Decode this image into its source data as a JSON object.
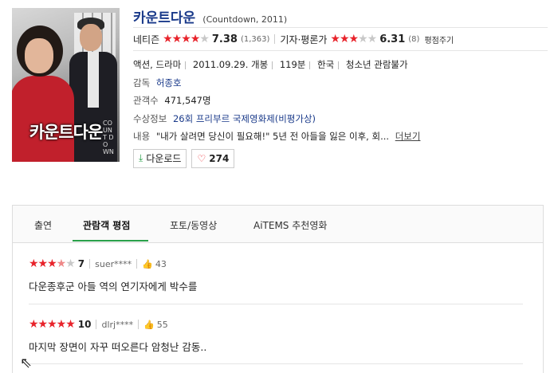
{
  "poster": {
    "title_text": "카운트다운",
    "side_text": "COUNT DOWN"
  },
  "movie": {
    "title": "카운트다운",
    "subtitle": "(Countdown, 2011)",
    "netizen": {
      "label": "네티즌",
      "stars": "★★★★",
      "stars_off": "★",
      "score": "7.38",
      "count": "(1,363)"
    },
    "critic": {
      "label": "기자·평론가",
      "stars": "★★★",
      "stars_off": "★★",
      "score": "6.31",
      "count": "(8)",
      "rate_link": "평점주기"
    },
    "genre": "액션, 드라마",
    "release": "2011.09.29. 개봉",
    "runtime": "119분",
    "country": "한국",
    "grade": "청소년 관람불가",
    "director_label": "감독",
    "director": "허종호",
    "audience_label": "관객수",
    "audience": "471,547명",
    "award_label": "수상정보",
    "award": "26회 프리부르 국제영화제(비평가상)",
    "plot_label": "내용",
    "plot": "\"내가 살려면 당신이 필요해!\" 5년 전 아들을 잃은 이후, 회...",
    "more": "더보기"
  },
  "buttons": {
    "download": "다운로드",
    "likes": "274"
  },
  "tabs": [
    "출연",
    "관람객 평점",
    "포토/동영상",
    "AiTEMS 추천영화"
  ],
  "reviews": [
    {
      "stars": "★★★",
      "half": "★",
      "stars_off": "★",
      "score": "7",
      "user": "suer****",
      "likes": "43",
      "text": "다운종후군 아들 역의 연기자에게 박수를"
    },
    {
      "stars": "★★★★★",
      "half": "",
      "stars_off": "",
      "score": "10",
      "user": "dlrj****",
      "likes": "55",
      "text": "마지막 장면이 자꾸 떠오른다 암청난 감동.."
    }
  ],
  "colors": {
    "accent_red": "#e8232b",
    "link_blue": "#1a3a8a",
    "tab_green": "#2aa04a"
  },
  "icons": {
    "download": "download-icon",
    "heart": "heart-icon",
    "thumb": "thumbs-up-icon",
    "cursor": "mouse-pointer-icon"
  }
}
